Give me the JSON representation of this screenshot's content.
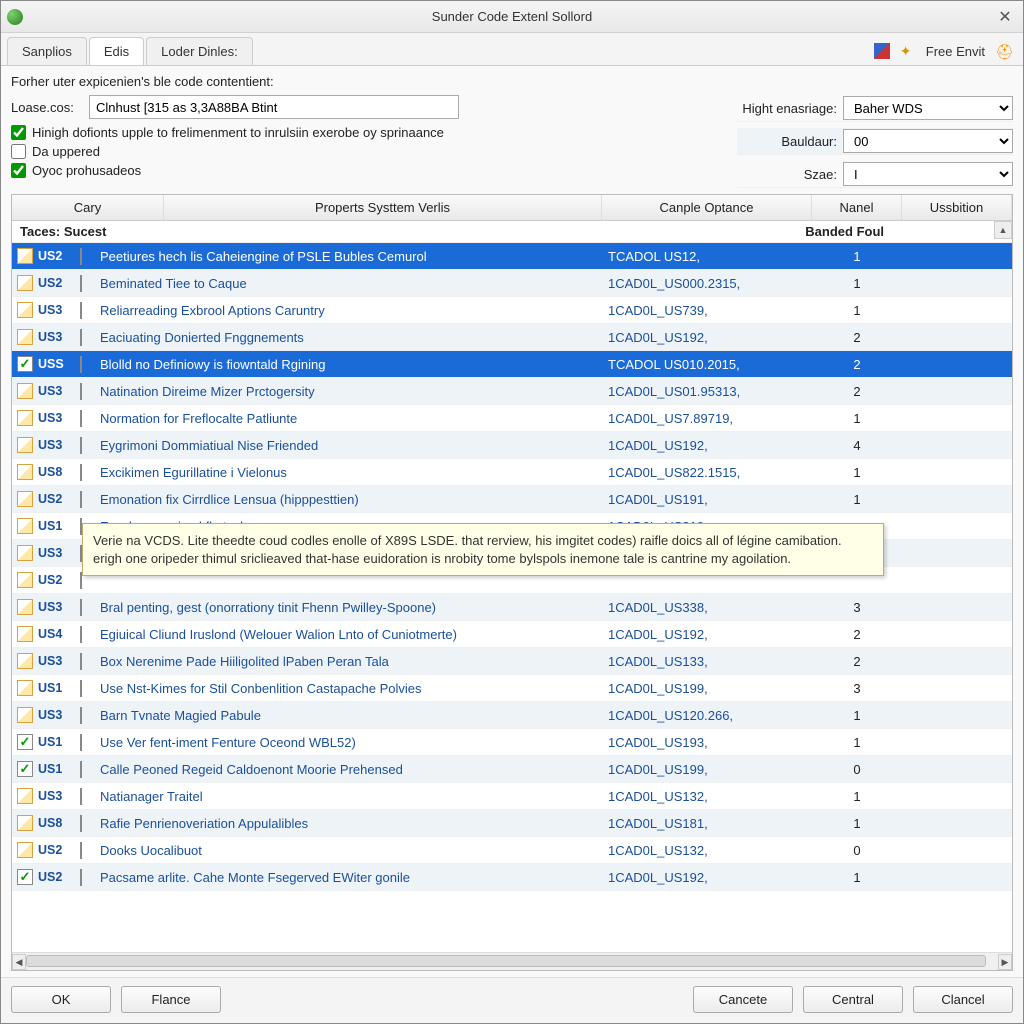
{
  "window": {
    "title": "Sunder Code Extenl Sollord"
  },
  "tabs": [
    {
      "label": "Sanplios",
      "active": false
    },
    {
      "label": "Edis",
      "active": true
    },
    {
      "label": "Loder Dinles:",
      "active": false
    }
  ],
  "toolbar_right": {
    "free_label": "Free Envit"
  },
  "form": {
    "heading": "Forher uter expicenien's ble code contentient:",
    "loase_label": "Loase.cos:",
    "loase_value": "Clnhust [315 as 3,3A88BA Btint",
    "chk1": "Hinigh dofionts upple to frelimenment to inrulsiin exerobe oy sprinaance",
    "chk2": "Da uppered",
    "chk3": "Oyoc prohusadeos",
    "hight_label": "Hight enasriage:",
    "hight_val": "Baher WDS",
    "bauld_label": "Bauldaur:",
    "bauld_val": "00",
    "szae_label": "Szae:",
    "szae_val": "I"
  },
  "columns": {
    "c0": "Cary",
    "c1": "Properts Systtem Verlis",
    "c2": "Canple Optance",
    "c3": "Nanel",
    "c4": "Ussbition"
  },
  "subheader": {
    "left": "Taces: Sucest",
    "right": "Banded Foul"
  },
  "tooltip": "Verie na VCDS. Lite theedte coud codles enolle of X89S LSDE. that rerview, his imgitet codes) raifle doics all of légine camibation.\nerigh one oripeder thimul sriclieaved that-hase euidoration is nrobity tome bylspols inemone tale is cantrine my agoilation.",
  "rows": [
    {
      "sel": true,
      "chk": false,
      "tag": "US2",
      "name": "Peetiures hech lis Caheiengine of PSLE Bubles Cemurol",
      "code": "TCADOL US12,",
      "num": "1"
    },
    {
      "sel": false,
      "chk": false,
      "tag": "US2",
      "name": "Beminated Tiee to Caque",
      "code": "1CAD0L_US000.2315,",
      "num": "1"
    },
    {
      "sel": false,
      "chk": false,
      "tag": "US3",
      "name": "Reliarreading Exbrool Aptions Caruntry",
      "code": "1CAD0L_US739,",
      "num": "1"
    },
    {
      "sel": false,
      "chk": false,
      "tag": "US3",
      "name": "Eaciuating Donierted Fnggnements",
      "code": "1CAD0L_US192,",
      "num": "2"
    },
    {
      "sel": true,
      "chk": true,
      "tag": "USS",
      "name": "Blolld no Definiowy is fiowntald Rgining",
      "code": "TCADOL US010.2015,",
      "num": "2"
    },
    {
      "sel": false,
      "chk": false,
      "tag": "US3",
      "name": "Natination Direime Mizer Prctogersity",
      "code": "1CAD0L_US01.95313,",
      "num": "2"
    },
    {
      "sel": false,
      "chk": false,
      "tag": "US3",
      "name": "Normation for Freflocalte Patliunte",
      "code": "1CAD0L_US7.89719,",
      "num": "1"
    },
    {
      "sel": false,
      "chk": false,
      "tag": "US3",
      "name": "Eygrimoni Dommiatiual Nise Friended",
      "code": "1CAD0L_US192,",
      "num": "4"
    },
    {
      "sel": false,
      "chk": false,
      "tag": "US8",
      "name": "Excikimen Egurillatine i Vielonus",
      "code": "1CAD0L_US822.1515,",
      "num": "1"
    },
    {
      "sel": false,
      "chk": false,
      "tag": "US2",
      "name": "Emonation fix Cirrdlice Lensua (hipppesttien)",
      "code": "1CAD0L_US191,",
      "num": "1"
    },
    {
      "sel": false,
      "chk": false,
      "tag": "US1",
      "name": "Escul avammived fls·tyul",
      "code": "1CAD0L_US319",
      "num": ""
    },
    {
      "sel": false,
      "chk": false,
      "tag": "US3",
      "name": "",
      "code": "",
      "num": ""
    },
    {
      "sel": false,
      "chk": false,
      "tag": "US2",
      "name": "",
      "code": "",
      "num": ""
    },
    {
      "sel": false,
      "chk": false,
      "tag": "US3",
      "name": "Bral penting, gest (onorrationy tinit Fhenn Pwilley-Spoone)",
      "code": "1CAD0L_US338,",
      "num": "3"
    },
    {
      "sel": false,
      "chk": false,
      "tag": "US4",
      "name": "Egiuical Cliund Iruslond (Welouer Walion Lnto of Cuniotmerte)",
      "code": "1CAD0L_US192,",
      "num": "2"
    },
    {
      "sel": false,
      "chk": false,
      "tag": "US3",
      "name": "Box Nerenime Pade Hiiligolited lPaben Peran Tala",
      "code": "1CAD0L_US133,",
      "num": "2"
    },
    {
      "sel": false,
      "chk": false,
      "tag": "US1",
      "name": "Use Nst-Kimes for Stil Conbenlition Castapache Polvies",
      "code": "1CAD0L_US199,",
      "num": "3"
    },
    {
      "sel": false,
      "chk": false,
      "tag": "US3",
      "name": "Barn Tvnate Magied Pabule",
      "code": "1CAD0L_US120.266,",
      "num": "1"
    },
    {
      "sel": false,
      "chk": true,
      "tag": "US1",
      "name": "Use Ver fent-iment Fenture Oceond WBL52)",
      "code": "1CAD0L_US193,",
      "num": "1"
    },
    {
      "sel": false,
      "chk": true,
      "tag": "US1",
      "name": "Calle Peoned Regeid Caldoenont Moorie Prehensed",
      "code": "1CAD0L_US199,",
      "num": "0"
    },
    {
      "sel": false,
      "chk": false,
      "tag": "US3",
      "name": "Natianager Traitel",
      "code": "1CAD0L_US132,",
      "num": "1"
    },
    {
      "sel": false,
      "chk": false,
      "tag": "US8",
      "name": "Rafie Penrienoveriation Appulalibles",
      "code": "1CAD0L_US181,",
      "num": "1"
    },
    {
      "sel": false,
      "chk": false,
      "tag": "US2",
      "name": "Dooks Uocalibuot",
      "code": "1CAD0L_US132,",
      "num": "0"
    },
    {
      "sel": false,
      "chk": true,
      "tag": "US2",
      "name": "Pacsame arlite. Cahe Monte Fsegerved EWiter gonile",
      "code": "1CAD0L_US192,",
      "num": "1"
    }
  ],
  "buttons": {
    "ok": "OK",
    "flance": "Flance",
    "cancete": "Cancete",
    "central": "Central",
    "clancel": "Clancel"
  }
}
